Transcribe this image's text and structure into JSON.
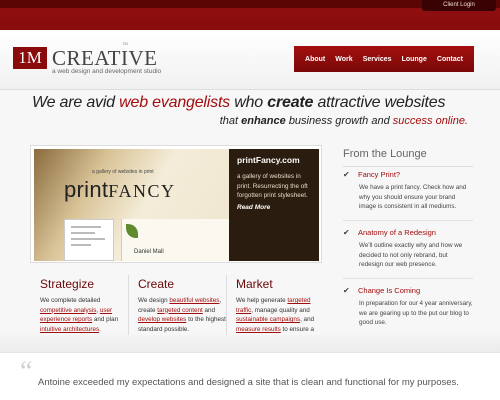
{
  "header": {
    "client_login": "Client Login",
    "logo_mark": "1M",
    "logo_word": "CREATIVE",
    "logo_tm": "TM",
    "tagline": "a web design and development studio"
  },
  "nav": {
    "items": [
      {
        "label": "About"
      },
      {
        "label": "Work"
      },
      {
        "label": "Services"
      },
      {
        "label": "Lounge"
      },
      {
        "label": "Contact"
      }
    ]
  },
  "hero": {
    "line1_a": "We are avid",
    "line1_b": "web evangelists",
    "line1_c": "who",
    "line1_d": "create",
    "line1_e": "attractive websites",
    "line2_a": "that",
    "line2_b": "enhance",
    "line2_c": "business growth and",
    "line2_d": "success online."
  },
  "feature": {
    "art_tagline": "a gallery of websites in print",
    "art_big_a": "print",
    "art_big_b": "FANCY",
    "art_author": "Daniel Mall",
    "title": "printFancy.com",
    "description": "a gallery of websites in print. Resurrecting the oft forgotten print stylesheet.",
    "read_more": "Read More"
  },
  "columns": [
    {
      "title": "Strategize",
      "t1": "We complete detailed",
      "l1": "competitive analysis",
      "t2": ",",
      "l2": "user experience reports",
      "t3": "and plan",
      "l3": "intuitive architectures",
      "t4": "."
    },
    {
      "title": "Create",
      "t1": "We design",
      "l1": "beautiful websites",
      "t2": ", create",
      "l2": "targeted content",
      "t3": "and",
      "l3": "develop websites",
      "t4": "to the highest standard possible."
    },
    {
      "title": "Market",
      "t1": "We help generate",
      "l1": "targeted traffic",
      "t2": ", manage quality and",
      "l2": "sustainable campaigns",
      "t3": ", and",
      "l3": "measure results",
      "t4": "to ensure a great ROI."
    }
  ],
  "sidebar": {
    "title": "From the Lounge",
    "items": [
      {
        "title": "Fancy Print?",
        "text": "We have a print fancy. Check how and why you should ensure your brand image is consistent in all mediums."
      },
      {
        "title": "Anatomy of a Redesign",
        "text": "We'll outline exactly why and how we decided to not only rebrand, but redesign our web presence."
      },
      {
        "title": "Change Is Coming",
        "text": "In preparation for our 4 year anniversary, we are gearing up to the put our blog to good use."
      }
    ]
  },
  "testimonial": {
    "quote_mark": "“",
    "text": "Antoine exceeded my expectations and designed a site that is clean and functional for my purposes."
  },
  "colors": {
    "brand_red": "#a10d0d",
    "dark_red": "#7e0a0a"
  }
}
